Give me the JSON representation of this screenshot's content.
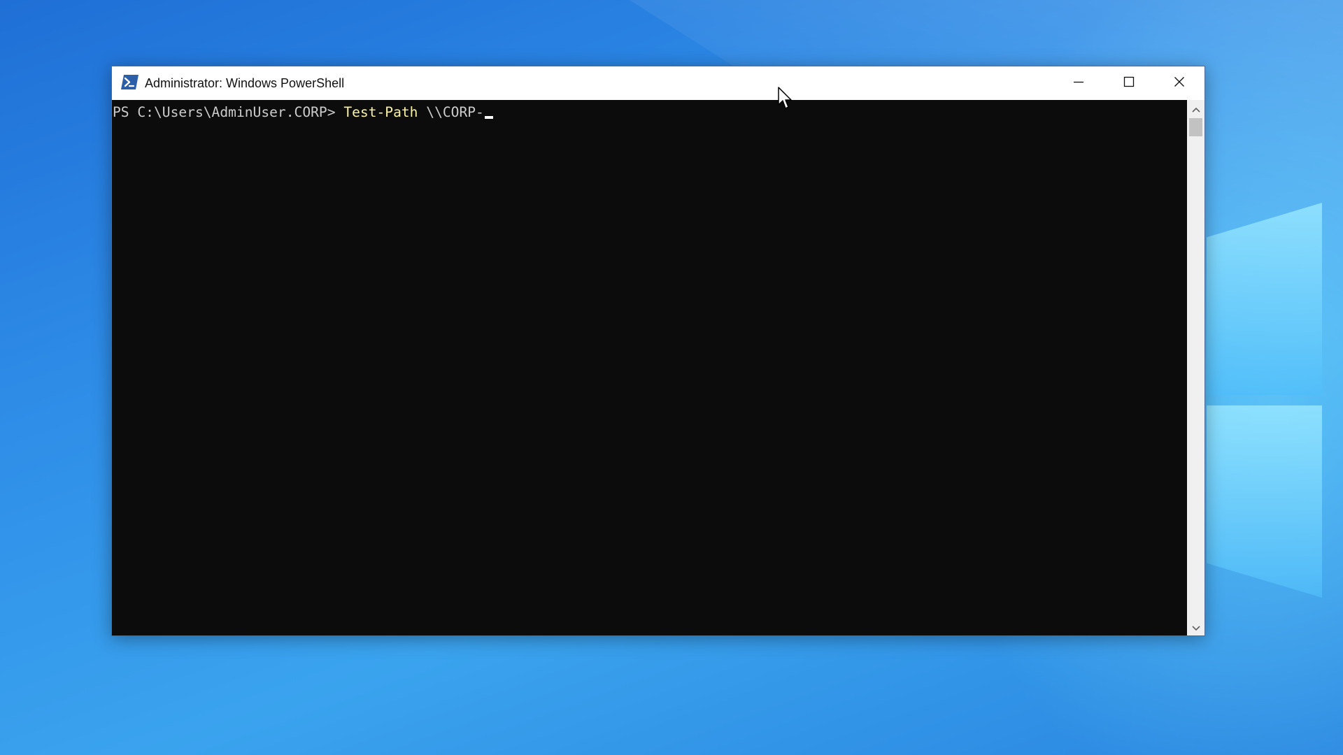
{
  "window": {
    "title": "Administrator: Windows PowerShell",
    "app_icon": "powershell-icon"
  },
  "caption_buttons": {
    "minimize_icon": "minimize-icon",
    "maximize_icon": "maximize-icon",
    "close_icon": "close-icon"
  },
  "console": {
    "prompt": "PS C:\\Users\\AdminUser.CORP> ",
    "command": "Test-Path",
    "argument": " \\\\CORP-"
  },
  "scrollbar": {
    "up_icon": "chevron-up-icon",
    "down_icon": "chevron-down-icon"
  },
  "colors": {
    "console_background": "#0c0c0c",
    "console_text": "#cccccc",
    "command_text": "#f9f1a5",
    "titlebar": "#ffffff",
    "desktop_accent": "#2f8ee8"
  }
}
